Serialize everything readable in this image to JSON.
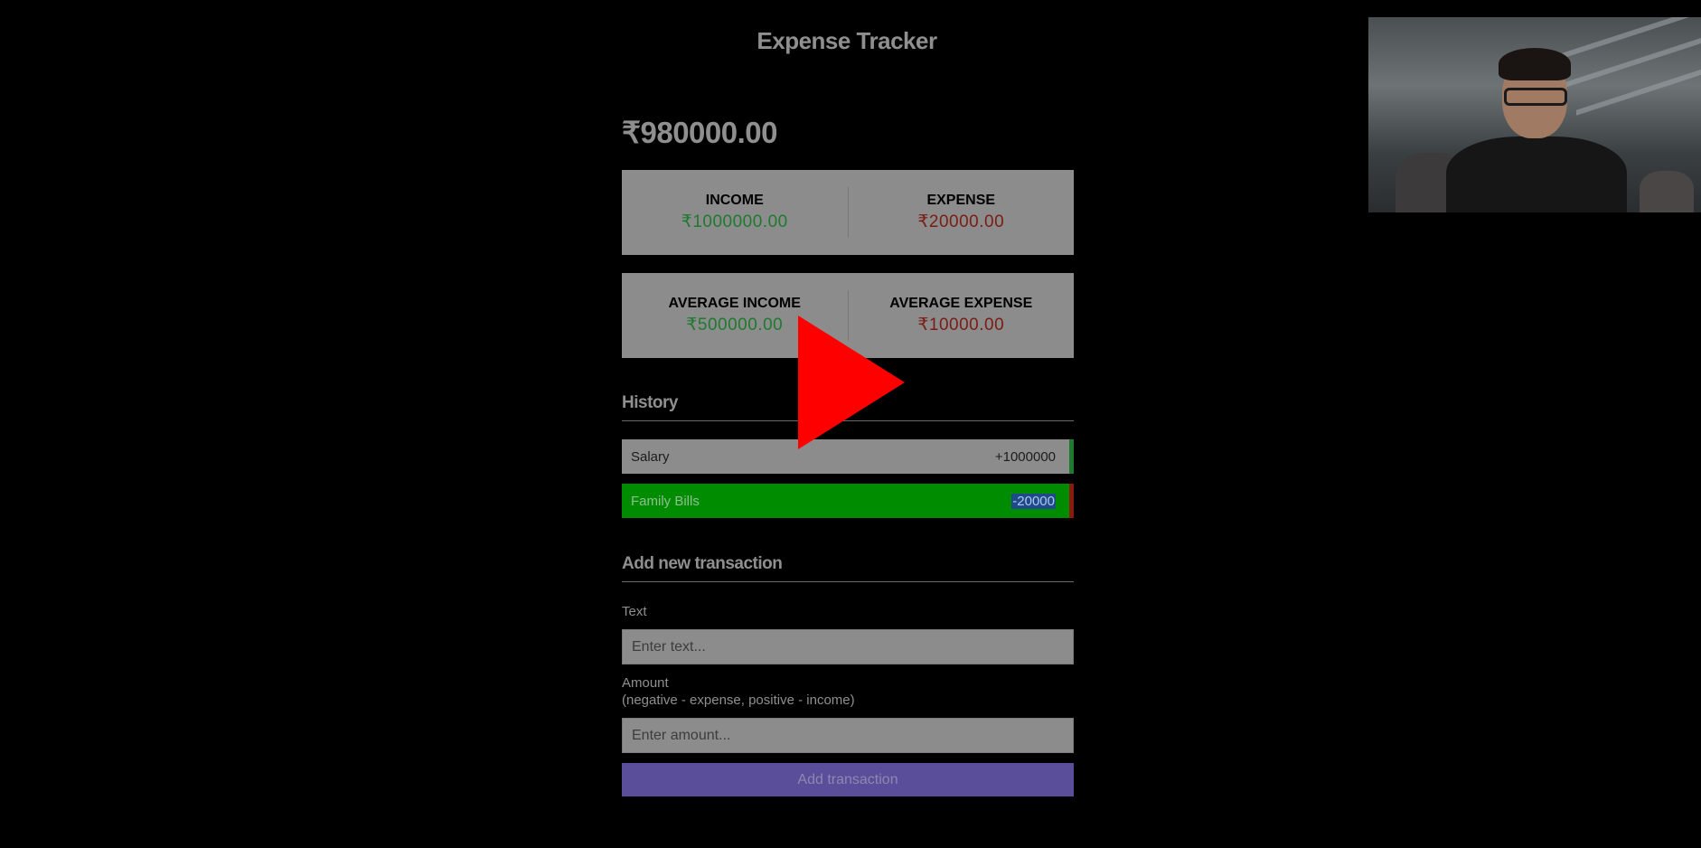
{
  "app": {
    "title": "Expense Tracker"
  },
  "balance": {
    "value": "₹980000.00"
  },
  "summary": {
    "income_label": "INCOME",
    "income_value": "₹1000000.00",
    "expense_label": "EXPENSE",
    "expense_value": "₹20000.00"
  },
  "averages": {
    "avg_income_label": "AVERAGE INCOME",
    "avg_income_value": "₹500000.00",
    "avg_expense_label": "AVERAGE EXPENSE",
    "avg_expense_value": "₹10000.00"
  },
  "history": {
    "title": "History",
    "items": [
      {
        "text": "Salary",
        "amount": "+1000000",
        "type": "income"
      },
      {
        "text": "Family Bills",
        "amount": "-20000",
        "type": "expense"
      }
    ]
  },
  "form": {
    "title": "Add new transaction",
    "text_label": "Text",
    "text_placeholder": "Enter text...",
    "amount_label": "Amount",
    "amount_hint": "(negative - expense, positive - income)",
    "amount_placeholder": "Enter amount...",
    "submit_label": "Add transaction"
  },
  "colors": {
    "income": "#1e7a2e",
    "expense": "#7a1c14",
    "button": "#5a4e9a",
    "play": "#ff0000"
  },
  "icons": {
    "play": "play-icon"
  }
}
